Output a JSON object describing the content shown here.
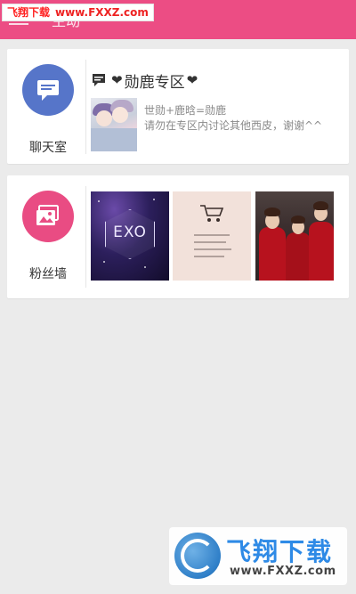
{
  "header": {
    "title": "主动"
  },
  "watermark_top": {
    "site_name": "飞翔下载",
    "url": "www.FXXZ.com"
  },
  "chat_room": {
    "caption": "聊天室",
    "zone_title": "勋鹿专区",
    "heart_glyph": "❤",
    "desc_line1": "世勋+鹿晗=勋鹿",
    "desc_line2": "请勿在专区内讨论其他西皮，谢谢^^",
    "accent_color": "#5675c9"
  },
  "fan_wall": {
    "caption": "粉丝墙",
    "photo1_text": "EXO",
    "accent_color": "#e94c83"
  },
  "watermark_bottom": {
    "brand": "飞翔下载",
    "url": "www.FXXZ.com"
  }
}
